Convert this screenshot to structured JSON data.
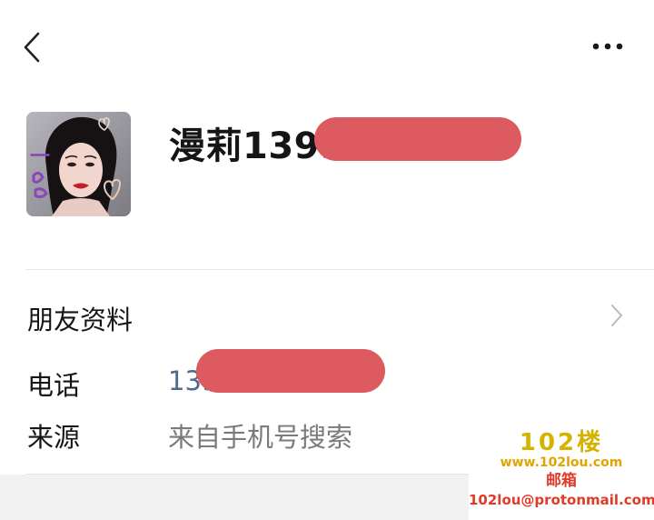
{
  "profile": {
    "nickname": "漫莉1399"
  },
  "friend_info": {
    "label": "朋友资料"
  },
  "phone": {
    "label": "电话",
    "value": "139"
  },
  "source": {
    "label": "来源",
    "value": "来自手机号搜索"
  },
  "watermark": {
    "logo": "102楼",
    "site": "www.102lou.com",
    "mail_label": "邮箱",
    "email": "102lou@protonmail.com"
  },
  "colors": {
    "redaction": "#dd5b60",
    "link_blue": "#4e6a8c",
    "watermark_gold": "#d4b200",
    "watermark_red": "#e03a28"
  },
  "icons": {
    "back": "chevron-left-icon",
    "more": "more-dots-icon",
    "friend_info_arrow": "chevron-right-icon"
  }
}
